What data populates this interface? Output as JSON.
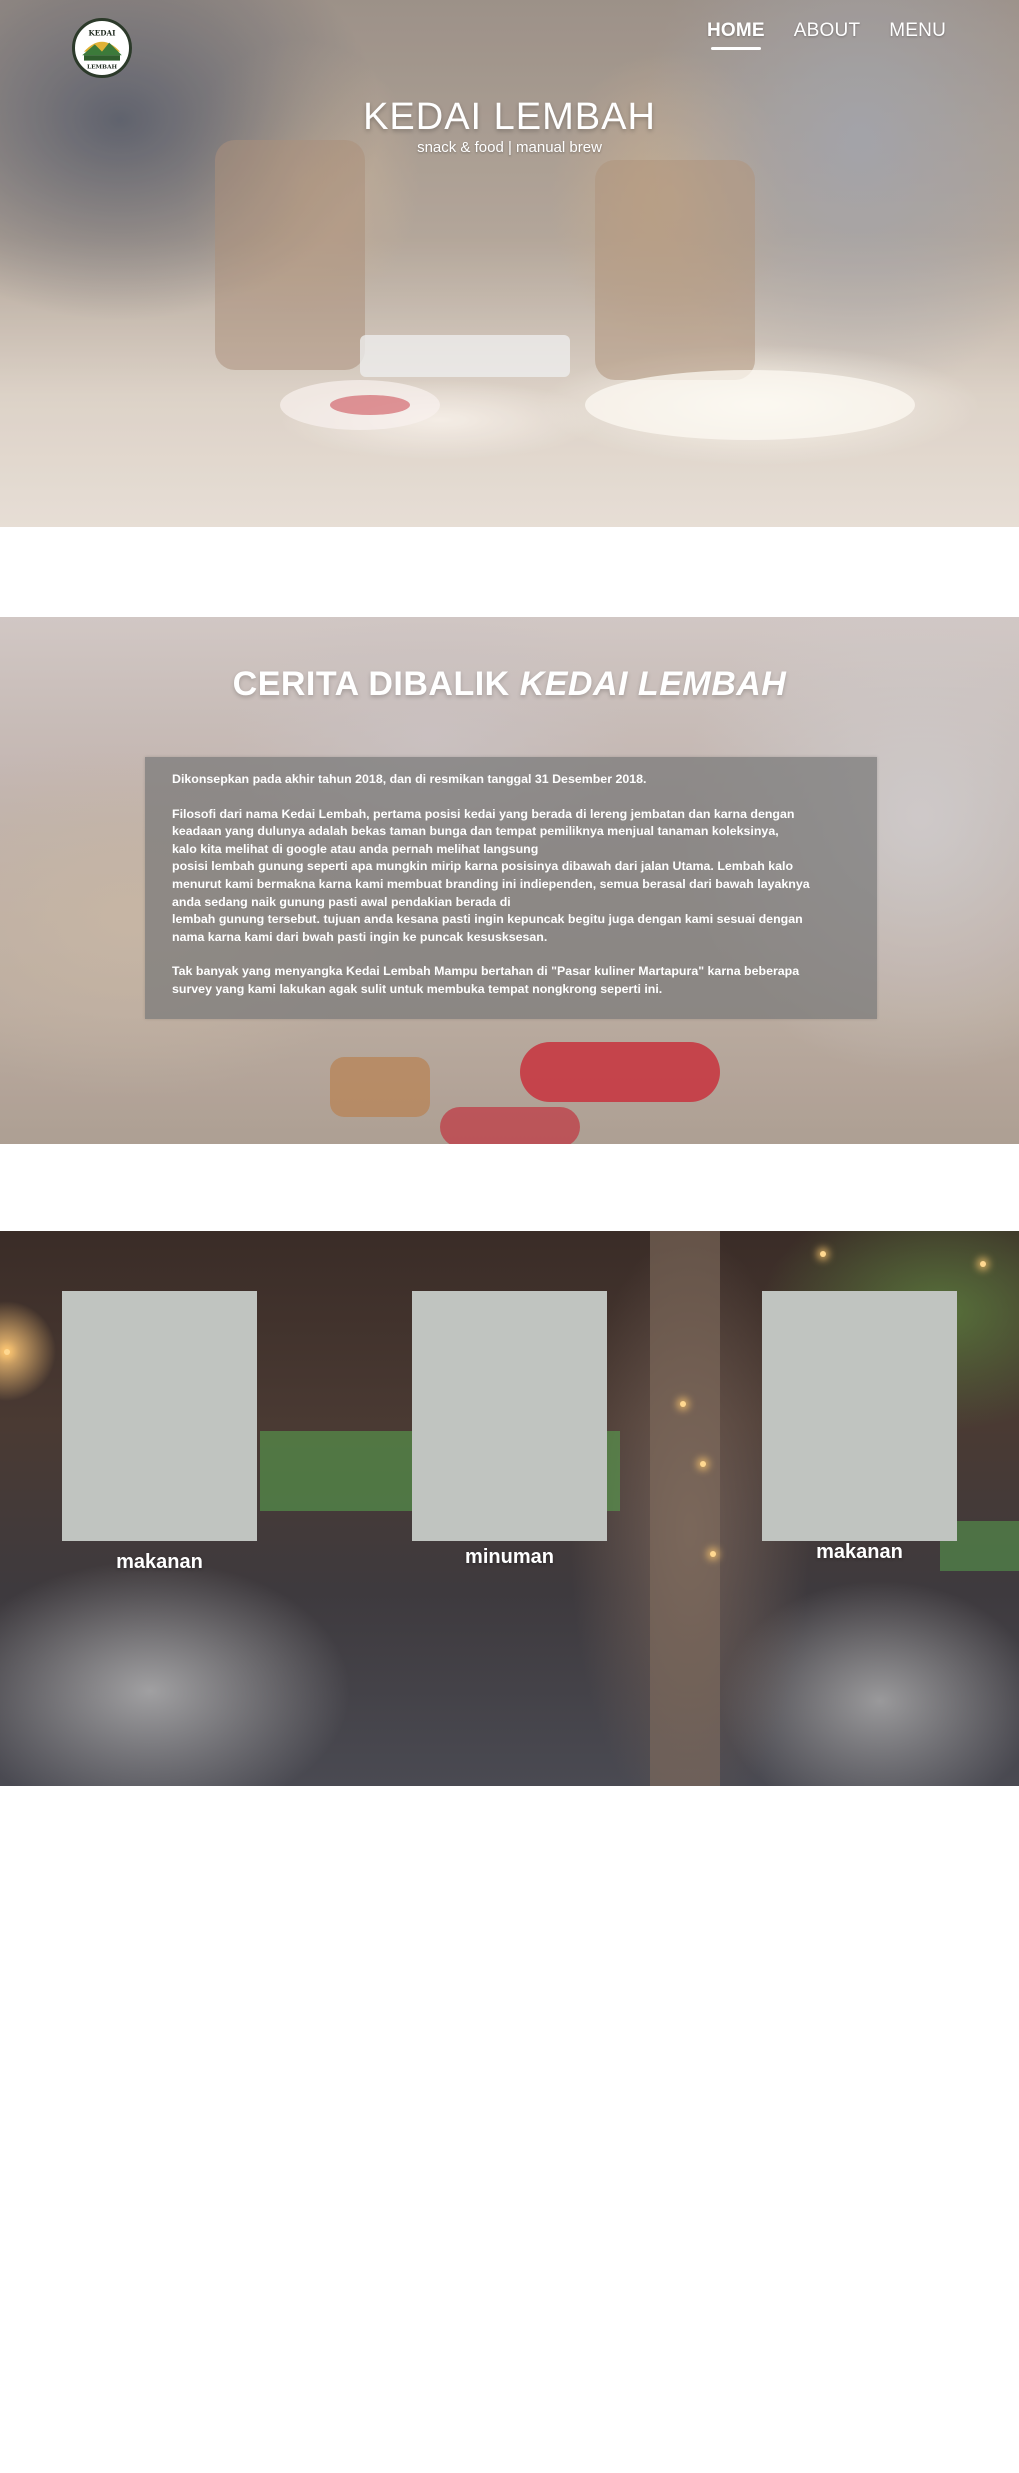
{
  "site": {
    "logo_text_top": "KEDAI",
    "logo_text_bottom": "LEMBAH"
  },
  "nav": {
    "items": [
      {
        "label": "HOME",
        "active": true
      },
      {
        "label": "ABOUT",
        "active": false
      },
      {
        "label": "MENU",
        "active": false
      }
    ]
  },
  "hero": {
    "title": "KEDAI LEMBAH",
    "subtitle": "snack & food | manual brew"
  },
  "about": {
    "title_prefix": "CERITA DIBALIK ",
    "title_emphasis": "KEDAI LEMBAH",
    "paragraph_1": "Dikonsepkan pada akhir tahun 2018, dan di resmikan tanggal 31 Desember 2018.",
    "paragraph_2": "Filosofi dari nama Kedai Lembah, pertama posisi kedai yang berada di lereng jembatan dan karna dengan\nkeadaan yang dulunya adalah bekas taman bunga dan tempat pemiliknya menjual tanaman koleksinya,\n kalo kita melihat di google atau anda pernah melihat langsung\n posisi lembah gunung seperti apa mungkin mirip karna posisinya dibawah dari jalan Utama. Lembah kalo\nmenurut kami bermakna karna kami membuat branding ini indiependen, semua berasal dari bawah layaknya\nanda sedang naik gunung pasti awal pendakian berada di\n lembah gunung tersebut. tujuan anda kesana pasti ingin kepuncak begitu juga dengan kami sesuai dengan\nnama karna kami dari bwah pasti ingin ke puncak kesusksesan.",
    "paragraph_3": "Tak banyak yang menyangka Kedai Lembah Mampu bertahan di \"Pasar kuliner Martapura\" karna beberapa\nsurvey yang kami lakukan agak sulit untuk membuka tempat nongkrong seperti ini."
  },
  "menu": {
    "cards": [
      {
        "label": "makanan"
      },
      {
        "label": "minuman"
      },
      {
        "label": "makanan"
      }
    ]
  },
  "colors": {
    "text": "#ffffff",
    "about_box": "#787878",
    "card_placeholder": "#c0c4c0",
    "page_background": "#ffffff"
  }
}
